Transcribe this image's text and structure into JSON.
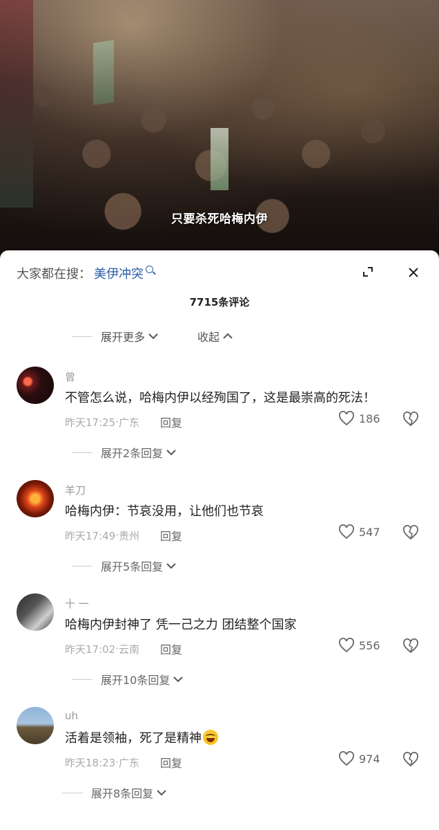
{
  "video": {
    "subtitle": "只要杀死哈梅内伊"
  },
  "sheet": {
    "search_label": "大家都在搜：",
    "search_term": "美伊冲突",
    "comment_count": "7715条评论",
    "expand_more": "展开更多",
    "collapse": "收起",
    "icons": [
      "search-icon",
      "expand-icon",
      "close-icon",
      "chevron-down-icon",
      "chevron-up-icon",
      "heart-icon",
      "dislike-icon"
    ]
  },
  "comments": [
    {
      "username": "曾",
      "text": "不管怎么说，哈梅内伊以经殉国了，这是最崇高的死法！",
      "time": "昨天17:25",
      "location": "广东",
      "reply": "回复",
      "likes": "186",
      "expand_replies": "展开2条回复"
    },
    {
      "username": "羊刀",
      "text": "哈梅内伊：节哀没用，让他们也节哀",
      "time": "昨天17:49",
      "location": "贵州",
      "reply": "回复",
      "likes": "547",
      "expand_replies": "展开5条回复"
    },
    {
      "username": "十 一",
      "text": "哈梅内伊封神了 凭一己之力 团结整个国家",
      "time": "昨天17:02",
      "location": "云南",
      "reply": "回复",
      "likes": "556",
      "expand_replies": "展开10条回复"
    },
    {
      "username": "uh",
      "text": "活着是领袖，死了是精神",
      "time": "昨天18:23",
      "location": "广东",
      "reply": "回复",
      "likes": "974",
      "expand_replies": "展开8条回复"
    }
  ],
  "meta_separator": " · "
}
